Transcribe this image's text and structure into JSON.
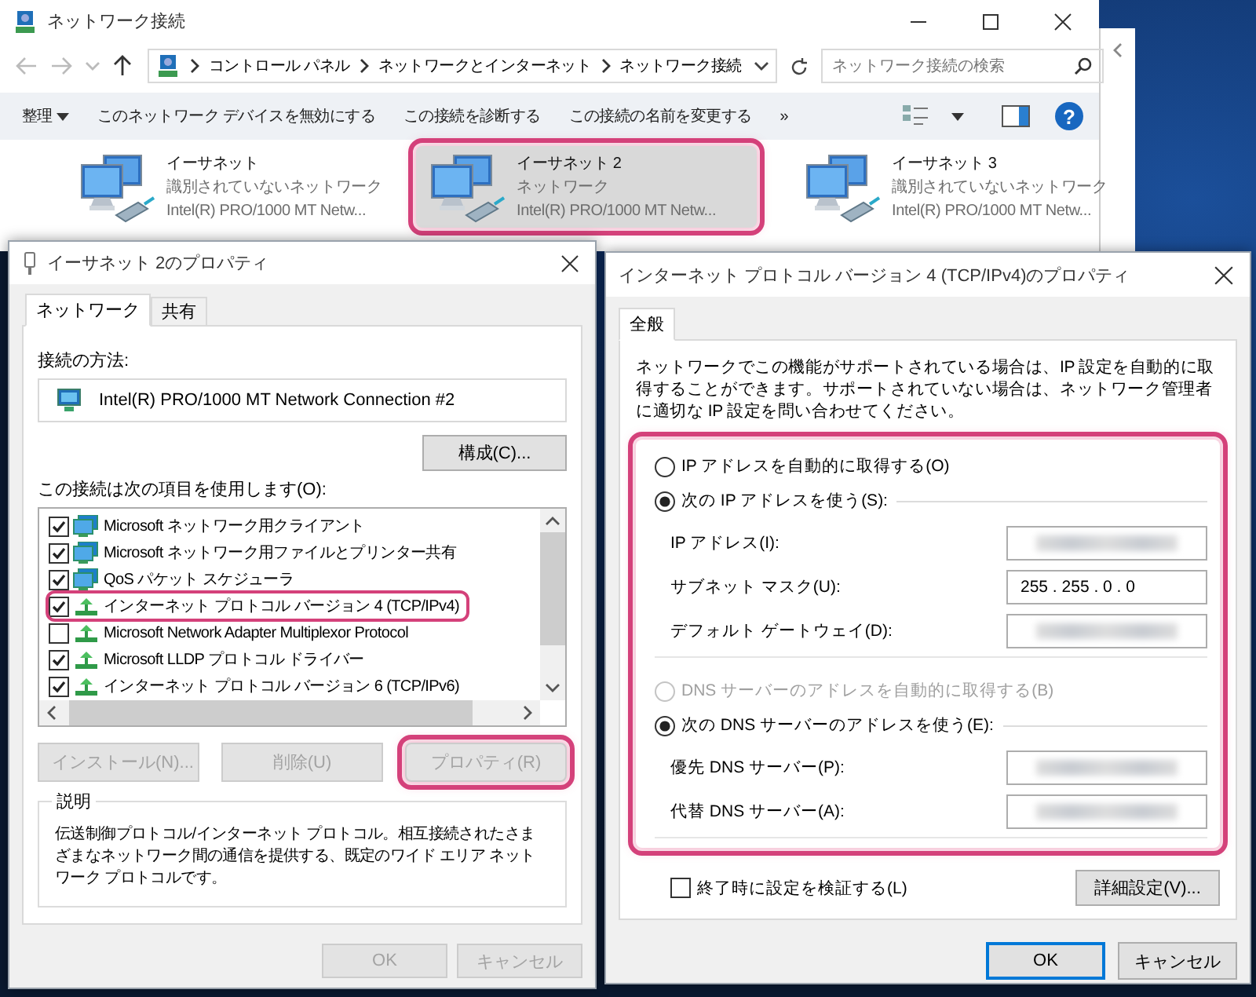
{
  "explorer": {
    "title": "ネットワーク接続",
    "breadcrumbs": [
      "コントロール パネル",
      "ネットワークとインターネット",
      "ネットワーク接続"
    ],
    "search": {
      "placeholder": "ネットワーク接続の検索"
    },
    "toolbar": [
      {
        "label": "整理",
        "kind": "menu"
      },
      {
        "label": "このネットワーク デバイスを無効にする",
        "kind": "command"
      },
      {
        "label": "この接続を診断する",
        "kind": "command"
      },
      {
        "label": "この接続の名前を変更する",
        "kind": "command"
      },
      {
        "label": "»",
        "kind": "overflow"
      }
    ],
    "help": "?",
    "adapters": [
      {
        "name": "イーサネット",
        "network": "識別されていないネットワーク",
        "device": "Intel(R) PRO/1000 MT Netw...",
        "selected": false,
        "highlighted": false
      },
      {
        "name": "イーサネット 2",
        "network": "ネットワーク",
        "device": "Intel(R) PRO/1000 MT Netw...",
        "selected": true,
        "highlighted": true
      },
      {
        "name": "イーサネット 3",
        "network": "識別されていないネットワーク",
        "device": "Intel(R) PRO/1000 MT Netw...",
        "selected": false,
        "highlighted": false
      }
    ]
  },
  "adapter_properties": {
    "title": "イーサネット 2のプロパティ",
    "tabs": [
      {
        "label": "ネットワーク",
        "selected": true
      },
      {
        "label": "共有",
        "selected": false
      }
    ],
    "connect_using_label": "接続の方法:",
    "adapter": "Intel(R) PRO/1000 MT Network Connection #2",
    "configure_button": "構成(C)...",
    "items_label": "この接続は次の項目を使用します(O):",
    "items": [
      {
        "label": "Microsoft ネットワーク用クライアント",
        "kind": "service",
        "checked": true,
        "highlighted": false
      },
      {
        "label": "Microsoft ネットワーク用ファイルとプリンター共有",
        "kind": "service",
        "checked": true,
        "highlighted": false
      },
      {
        "label": "QoS パケット スケジューラ",
        "kind": "service",
        "checked": true,
        "highlighted": false
      },
      {
        "label": "インターネット プロトコル バージョン 4 (TCP/IPv4)",
        "kind": "protocol",
        "checked": true,
        "highlighted": true
      },
      {
        "label": "Microsoft Network Adapter Multiplexor Protocol",
        "kind": "protocol",
        "checked": false,
        "highlighted": false
      },
      {
        "label": "Microsoft LLDP プロトコル ドライバー",
        "kind": "protocol",
        "checked": true,
        "highlighted": false
      },
      {
        "label": "インターネット プロトコル バージョン 6 (TCP/IPv6)",
        "kind": "protocol",
        "checked": true,
        "highlighted": false
      }
    ],
    "buttons": [
      {
        "label": "インストール(N)...",
        "disabled": true,
        "highlighted": false
      },
      {
        "label": "削除(U)",
        "disabled": true,
        "highlighted": false
      },
      {
        "label": "プロパティ(R)",
        "disabled": true,
        "highlighted": true
      }
    ],
    "description": {
      "title": "説明",
      "text": "伝送制御プロトコル/インターネット プロトコル。相互接続されたさまざまなネットワーク間の通信を提供する、既定のワイド エリア ネットワーク プロトコルです。"
    },
    "footer_buttons": [
      {
        "label": "OK",
        "disabled": true
      },
      {
        "label": "キャンセル",
        "disabled": true
      }
    ]
  },
  "ipv4_properties": {
    "title": "インターネット プロトコル バージョン 4 (TCP/IPv4)のプロパティ",
    "tabs": [
      {
        "label": "全般",
        "selected": true
      }
    ],
    "intro": "ネットワークでこの機能がサポートされている場合は、IP 設定を自動的に取得することができます。サポートされていない場合は、ネットワーク管理者に適切な IP 設定を問い合わせてください。",
    "settings": {
      "highlighted": true,
      "ip_mode": [
        {
          "label": "IP アドレスを自動的に取得する(O)",
          "selected": false,
          "disabled": false
        },
        {
          "label": "次の IP アドレスを使う(S):",
          "selected": true,
          "disabled": false
        }
      ],
      "ip_fields": [
        {
          "label": "IP アドレス(I):",
          "redacted": true
        },
        {
          "label": "サブネット マスク(U):",
          "value": "255 . 255 . 0 . 0",
          "redacted": false
        },
        {
          "label": "デフォルト ゲートウェイ(D):",
          "redacted": true
        }
      ],
      "dns_mode": [
        {
          "label": "DNS サーバーのアドレスを自動的に取得する(B)",
          "selected": false,
          "disabled": true
        },
        {
          "label": "次の DNS サーバーのアドレスを使う(E):",
          "selected": true,
          "disabled": false
        }
      ],
      "dns_fields": [
        {
          "label": "優先 DNS サーバー(P):",
          "redacted": true
        },
        {
          "label": "代替 DNS サーバー(A):",
          "redacted": true
        }
      ]
    },
    "validate_on_exit": {
      "label": "終了時に設定を検証する(L)",
      "checked": false
    },
    "advanced_button": "詳細設定(V)...",
    "footer_buttons": [
      {
        "label": "OK",
        "default": true
      },
      {
        "label": "キャンセル",
        "default": false
      }
    ]
  }
}
